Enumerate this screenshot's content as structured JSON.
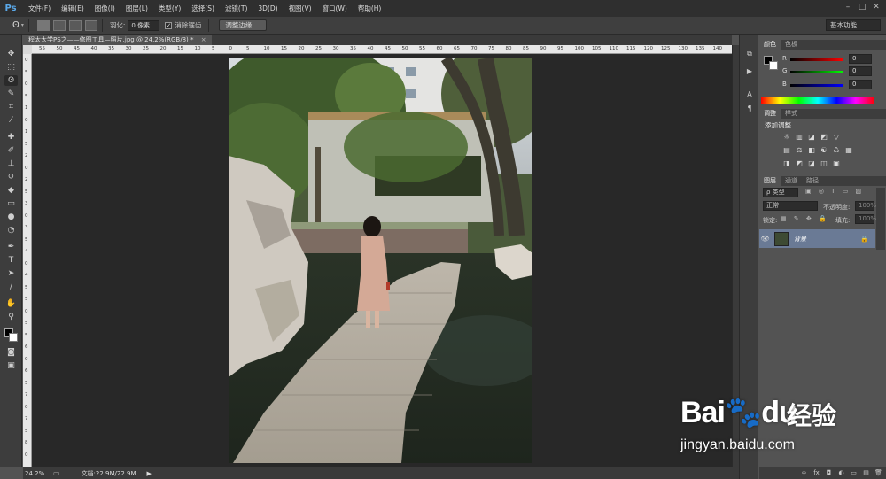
{
  "app": {
    "logo": "Ps",
    "menu": [
      "文件(F)",
      "编辑(E)",
      "图像(I)",
      "图层(L)",
      "类型(Y)",
      "选择(S)",
      "滤镜(T)",
      "3D(D)",
      "视图(V)",
      "窗口(W)",
      "帮助(H)"
    ],
    "window_controls": [
      "–",
      "□",
      "✕"
    ]
  },
  "options_bar": {
    "feather_label": "羽化:",
    "feather_value": "0 像素",
    "antialias_label": "消除锯齿",
    "antialias_checked": true,
    "refine_edge_label": "调整边缘 ...",
    "workspace": "基本功能"
  },
  "document": {
    "tab_title": "程太太学PS之——修图工具—照片.jpg @ 24.2%(RGB/8) *",
    "ruler_top": [
      "55",
      "50",
      "45",
      "40",
      "35",
      "30",
      "25",
      "20",
      "15",
      "10",
      "5",
      "0",
      "5",
      "10",
      "15",
      "20",
      "25",
      "30",
      "35",
      "40",
      "45",
      "50",
      "55",
      "60",
      "65",
      "70",
      "75",
      "80",
      "85",
      "90",
      "95",
      "100",
      "105",
      "110",
      "115",
      "120",
      "125",
      "130",
      "135",
      "140"
    ],
    "ruler_left": [
      "0",
      "5",
      "0",
      "5",
      "1",
      "0",
      "1",
      "5",
      "2",
      "0",
      "2",
      "5",
      "3",
      "0",
      "3",
      "5",
      "4",
      "0",
      "4",
      "5",
      "5",
      "0",
      "5",
      "5",
      "6",
      "0",
      "6",
      "5",
      "7",
      "0",
      "7",
      "5",
      "8",
      "0"
    ]
  },
  "status": {
    "zoom": "24.2%",
    "doc_size": "文档:22.9M/22.9M",
    "arrow": "▶"
  },
  "color_panel": {
    "tabs": [
      "颜色",
      "色板"
    ],
    "channels": [
      {
        "label": "R",
        "value": "0",
        "color": "#d33"
      },
      {
        "label": "G",
        "value": "0",
        "color": "#3c3"
      },
      {
        "label": "B",
        "value": "0",
        "color": "#33d"
      }
    ]
  },
  "adjust_panel": {
    "tabs": [
      "调整",
      "样式"
    ],
    "title": "添加调整",
    "row1": [
      "☼",
      "▥",
      "◪",
      "◩",
      "▽"
    ],
    "row2": [
      "▤",
      "⚖",
      "◧",
      "☯",
      "♺",
      "▦"
    ],
    "row3": [
      "◨",
      "◩",
      "◪",
      "◫",
      "▣"
    ]
  },
  "layers_panel": {
    "tabs": [
      "图层",
      "通道",
      "路径"
    ],
    "kind_filter": "ρ 类型",
    "blend_mode": "正常",
    "opacity_label": "不透明度:",
    "opacity_value": "100%",
    "lock_label": "锁定:",
    "fill_label": "填充:",
    "fill_value": "100%",
    "layer_name": "背景",
    "footer_icons": [
      "∞",
      "fx",
      "◘",
      "◐",
      "▭",
      "▤",
      "🗑"
    ]
  },
  "watermark": {
    "logo": "Bai🐾du",
    "cn": "经验",
    "url": "jingyan.baidu.com"
  }
}
